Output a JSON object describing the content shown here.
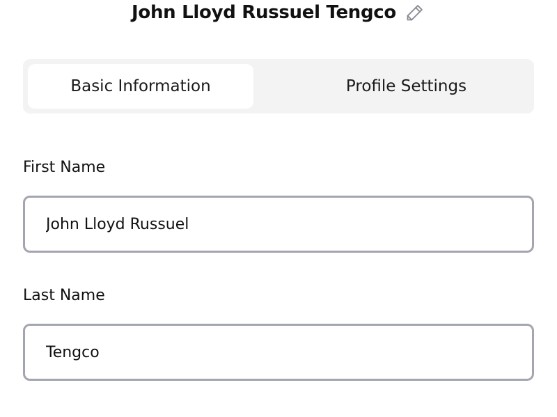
{
  "header": {
    "title": "John Lloyd Russuel Tengco",
    "edit_icon": "pencil-icon"
  },
  "tabs": [
    {
      "label": "Basic Information",
      "active": true
    },
    {
      "label": "Profile Settings",
      "active": false
    }
  ],
  "form": {
    "first_name": {
      "label": "First Name",
      "value": "John Lloyd Russuel"
    },
    "last_name": {
      "label": "Last Name",
      "value": "Tengco"
    }
  },
  "colors": {
    "tab_bar_background": "#f3f3f4",
    "active_tab_background": "#ffffff",
    "input_border": "#a3a5b0",
    "text": "#111111"
  }
}
